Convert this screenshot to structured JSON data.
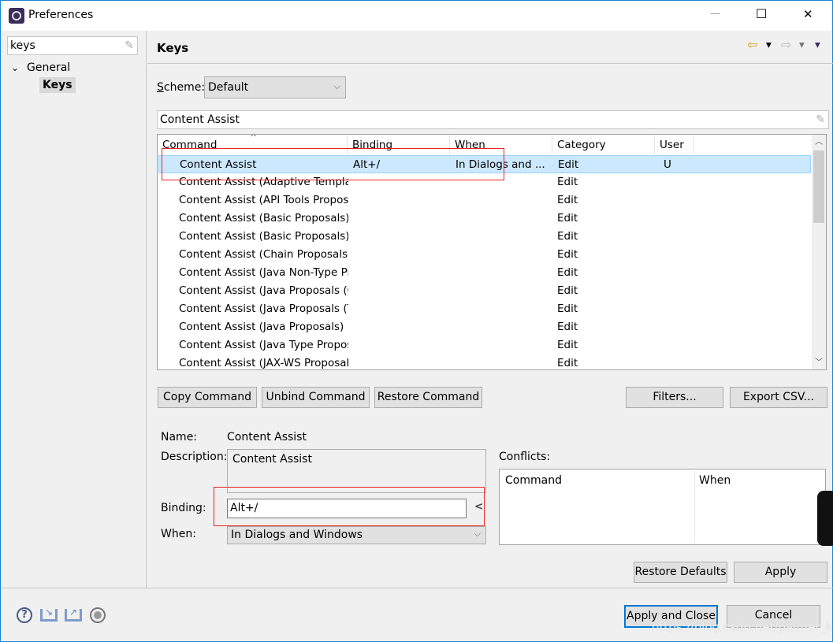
{
  "window": {
    "title": "Preferences",
    "minimize": "—",
    "maximize": "☐",
    "close": "✕"
  },
  "sidebar": {
    "filter_value": "keys",
    "tree": [
      {
        "label": "General",
        "expanded": true
      },
      {
        "label": "Keys",
        "selected": true
      }
    ]
  },
  "page": {
    "title": "Keys",
    "nav": {
      "back": "⇦",
      "forward": "⇨",
      "dropdown": "▾"
    }
  },
  "scheme": {
    "label": "Scheme:",
    "value": "Default"
  },
  "filter": {
    "value": "Content Assist"
  },
  "table": {
    "columns": [
      "Command",
      "Binding",
      "When",
      "Category",
      "User"
    ],
    "sort_indicator": "^",
    "rows": [
      {
        "command": "Content Assist",
        "binding": "Alt+/",
        "when": "In Dialogs and ...",
        "category": "Edit",
        "user": "U",
        "selected": true
      },
      {
        "command": "Content Assist (Adaptive Templa",
        "binding": "",
        "when": "",
        "category": "Edit",
        "user": ""
      },
      {
        "command": "Content Assist (API Tools Proposa",
        "binding": "",
        "when": "",
        "category": "Edit",
        "user": ""
      },
      {
        "command": "Content Assist (Basic Proposals)",
        "binding": "",
        "when": "",
        "category": "Edit",
        "user": ""
      },
      {
        "command": "Content Assist (Basic Proposals)",
        "binding": "",
        "when": "",
        "category": "Edit",
        "user": ""
      },
      {
        "command": "Content Assist (Chain Proposals (",
        "binding": "",
        "when": "",
        "category": "Edit",
        "user": ""
      },
      {
        "command": "Content Assist (Java Non-Type Pr",
        "binding": "",
        "when": "",
        "category": "Edit",
        "user": ""
      },
      {
        "command": "Content Assist (Java Proposals (C",
        "binding": "",
        "when": "",
        "category": "Edit",
        "user": ""
      },
      {
        "command": "Content Assist (Java Proposals (Ta",
        "binding": "",
        "when": "",
        "category": "Edit",
        "user": ""
      },
      {
        "command": "Content Assist (Java Proposals)",
        "binding": "",
        "when": "",
        "category": "Edit",
        "user": ""
      },
      {
        "command": "Content Assist (Java Type Propos",
        "binding": "",
        "when": "",
        "category": "Edit",
        "user": ""
      },
      {
        "command": "Content Assist (JAX-WS Proposal",
        "binding": "",
        "when": "",
        "category": "Edit",
        "user": ""
      }
    ]
  },
  "buttons": {
    "copy": "Copy Command",
    "unbind": "Unbind Command",
    "restore": "Restore Command",
    "filters": "Filters...",
    "export": "Export CSV...",
    "restore_defaults": "Restore Defaults",
    "apply": "Apply",
    "apply_close": "Apply and Close",
    "cancel": "Cancel"
  },
  "details": {
    "name_label": "Name:",
    "name_value": "Content Assist",
    "description_label": "Description:",
    "description_value": "Content Assist",
    "binding_label": "Binding:",
    "binding_value": "Alt+/",
    "binding_button": "<",
    "when_label": "When:",
    "when_value": "In Dialogs and Windows"
  },
  "conflicts": {
    "label": "Conflicts:",
    "columns": [
      "Command",
      "When"
    ]
  },
  "footer_icons": [
    "help-icon",
    "import-icon",
    "export-icon",
    "record-icon"
  ],
  "watermark": "https://blog.csdn.net/palmer_kai",
  "colors": {
    "selection": "#cce8ff",
    "annotation": "#e82424",
    "focus": "#0078d7"
  }
}
